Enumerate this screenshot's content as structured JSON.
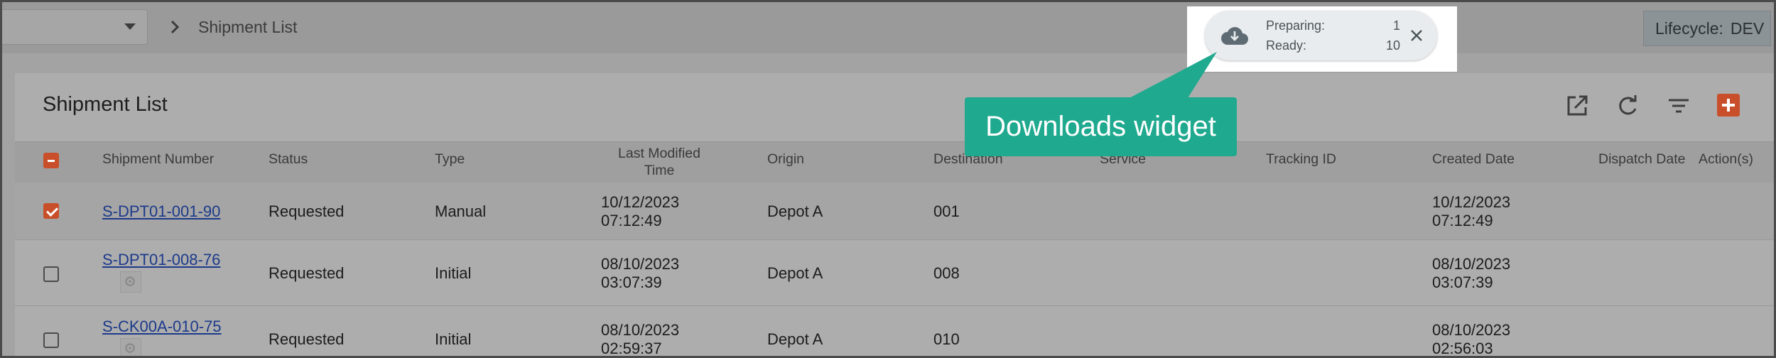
{
  "topbar": {
    "breadcrumb_current": "Shipment List",
    "lifecycle_label": "Lifecycle:",
    "lifecycle_value": "DEV"
  },
  "downloads_widget": {
    "preparing_label": "Preparing:",
    "preparing_count": "1",
    "ready_label": "Ready:",
    "ready_count": "10",
    "icon": "cloud-download-icon"
  },
  "callout": {
    "text": "Downloads widget",
    "color": "#1fa98f"
  },
  "page": {
    "title": "Shipment List",
    "toolbar_icons": [
      "open-in-new-icon",
      "refresh-icon",
      "filter-icon",
      "add-icon"
    ]
  },
  "table": {
    "columns": [
      "Shipment Number",
      "Status",
      "Type",
      "Last Modified Time",
      "Origin",
      "Destination",
      "Service",
      "Tracking ID",
      "Created Date",
      "Dispatch Date",
      "Action(s)"
    ],
    "col_last_modified_line1": "Last Modified",
    "col_last_modified_line2": "Time",
    "rows": [
      {
        "checked": true,
        "number": "S-DPT01-001-90",
        "status": "Requested",
        "type": "Manual",
        "modified_date": "10/12/2023",
        "modified_time": "07:12:49",
        "origin": "Depot A",
        "destination": "001",
        "service": "",
        "tracking": "",
        "created_date": "10/12/2023",
        "created_time": "07:12:49",
        "dispatch": ""
      },
      {
        "checked": false,
        "number": "S-DPT01-008-76",
        "status": "Requested",
        "type": "Initial",
        "modified_date": "08/10/2023",
        "modified_time": "03:07:39",
        "origin": "Depot A",
        "destination": "008",
        "service": "",
        "tracking": "",
        "created_date": "08/10/2023",
        "created_time": "03:07:39",
        "dispatch": ""
      },
      {
        "checked": false,
        "number": "S-CK00A-010-75",
        "status": "Requested",
        "type": "Initial",
        "modified_date": "08/10/2023",
        "modified_time": "02:59:37",
        "origin": "Depot A",
        "destination": "010",
        "service": "",
        "tracking": "",
        "created_date": "08/10/2023",
        "created_time": "02:56:03",
        "dispatch": ""
      }
    ]
  },
  "colors": {
    "accent": "#c94f2a",
    "link": "#1c3a8a",
    "overlay_grey": "#a9a9a9"
  }
}
